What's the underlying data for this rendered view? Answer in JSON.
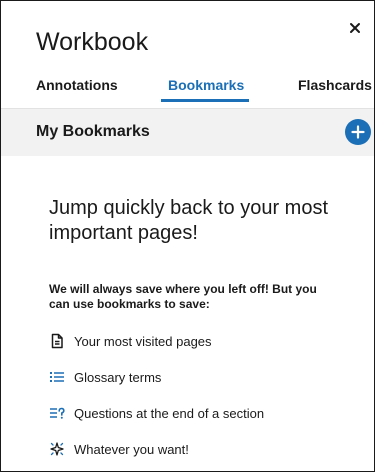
{
  "workbook": {
    "title": "Workbook",
    "close_icon": "close-icon"
  },
  "tabs": [
    {
      "label": "Annotations",
      "active": false
    },
    {
      "label": "Bookmarks",
      "active": true
    },
    {
      "label": "Flashcards",
      "active": false
    }
  ],
  "bookmarks": {
    "section_title": "My Bookmarks",
    "add_icon": "plus-circle-icon",
    "headline": "Jump quickly back to your most important pages!",
    "intro": "We will always save where you left off! But you can use bookmarks to save:",
    "items": [
      {
        "label": "Your most visited pages",
        "icon": "document-icon"
      },
      {
        "label": "Glossary terms",
        "icon": "list-icon"
      },
      {
        "label": "Questions at the end of a section",
        "icon": "question-list-icon"
      },
      {
        "label": "Whatever you want!",
        "icon": "sparkle-icon"
      }
    ]
  },
  "colors": {
    "accent": "#1b6fb6",
    "subheader_bg": "#f2f2f2",
    "text": "#1a1a1a"
  }
}
